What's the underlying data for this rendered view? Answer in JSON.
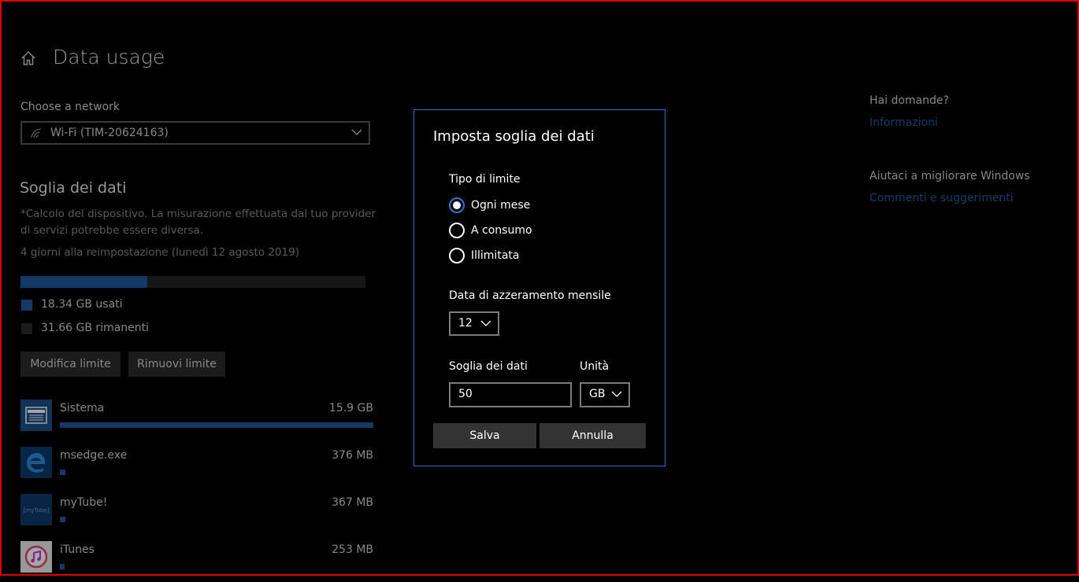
{
  "page": {
    "title": "Data usage"
  },
  "network": {
    "label": "Choose a network",
    "value": "Wi-Fi (TIM-20624163)"
  },
  "limit": {
    "title": "Soglia dei dati",
    "note": "*Calcolo del dispositivo. La misurazione effettuata dal tuo provider di servizi potrebbe essere diversa.",
    "reset": "4 giorni alla reimpostazione (lunedì 12 agosto 2019)",
    "used_fraction": 0.3668,
    "used_text": "18.34 GB usati",
    "remaining_text": "31.66 GB rimanenti",
    "edit_button": "Modifica limite",
    "remove_button": "Rimuovi limite"
  },
  "apps": [
    {
      "name": "Sistema",
      "size": "15.9 GB",
      "icon": "system-icon",
      "fraction": 1.0
    },
    {
      "name": "msedge.exe",
      "size": "376 MB",
      "icon": "edge-icon",
      "fraction": 0.018
    },
    {
      "name": "myTube!",
      "size": "367 MB",
      "icon": "mytube-icon",
      "icon_text": "[myTube]",
      "fraction": 0.018
    },
    {
      "name": "iTunes",
      "size": "253 MB",
      "icon": "itunes-icon",
      "fraction": 0.012
    }
  ],
  "sidebar": {
    "question1": "Hai domande?",
    "link1": "Informazioni",
    "question2": "Aiutaci a migliorare Windows",
    "link2": "Commenti e suggerimenti"
  },
  "dialog": {
    "title": "Imposta soglia dei dati",
    "type_label": "Tipo di limite",
    "options": [
      "Ogni mese",
      "A consumo",
      "Illimitata"
    ],
    "selected_option": "Ogni mese",
    "reset_label": "Data di azzeramento mensile",
    "reset_day": "12",
    "threshold_label": "Soglia dei dati",
    "unit_label": "Unità",
    "threshold_value": "50",
    "unit_value": "GB",
    "save_button": "Salva",
    "cancel_button": "Annulla"
  },
  "colors": {
    "accent": "#1e5a9b",
    "dialog_border": "#2f6ec4",
    "link": "#1f5d9c",
    "frame": "#e00000"
  }
}
